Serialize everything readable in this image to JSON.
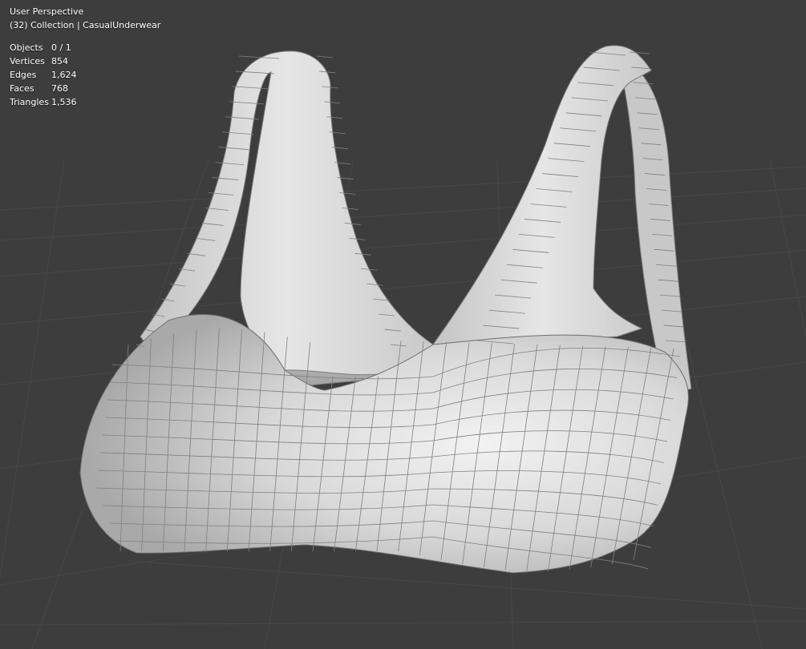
{
  "viewport": {
    "name": "User Perspective",
    "collection_info": "(32) Collection | CasualUnderwear"
  },
  "stats": [
    {
      "label": "Objects",
      "value": "0 / 1"
    },
    {
      "label": "Vertices",
      "value": "854"
    },
    {
      "label": "Edges",
      "value": "1,624"
    },
    {
      "label": "Faces",
      "value": "768"
    },
    {
      "label": "Triangles",
      "value": "1,536"
    }
  ],
  "colors": {
    "background": "#3d3d3d",
    "grid_line": "#474747",
    "mesh_fill": "#d9d9d9",
    "mesh_wire": "#7e7e7e",
    "overlay_text": "#ffffff"
  }
}
